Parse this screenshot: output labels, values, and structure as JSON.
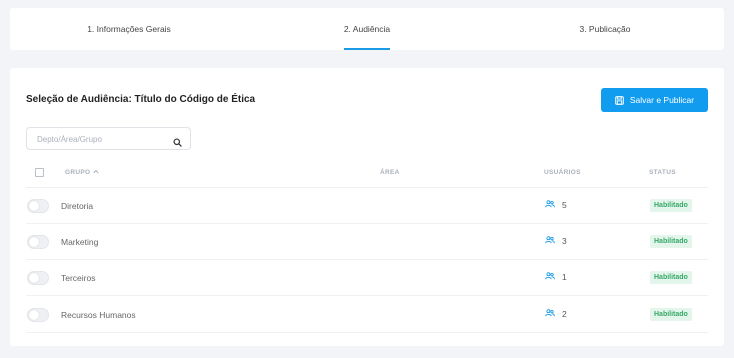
{
  "stepper": {
    "steps": [
      {
        "label": "1. Informações Gerais"
      },
      {
        "label": "2. Audiência"
      },
      {
        "label": "3. Publicação"
      }
    ],
    "active_step": 2
  },
  "main": {
    "title": "Seleção de Audiência: Título do Código de Ética",
    "publish_label": "Salvar e Publicar",
    "search_placeholder": "Depto/Área/Grupo",
    "search_value": ""
  },
  "table": {
    "headers": {
      "grupo": "GRUPO",
      "area": "ÁREA",
      "usuarios": "USUÁRIOS",
      "status": "STATUS"
    },
    "sort": {
      "column": "grupo",
      "direction": "asc"
    },
    "rows": [
      {
        "grupo": "Diretoria",
        "area": "",
        "usuarios": "5",
        "status": "Habilitado",
        "enabled": false
      },
      {
        "grupo": "Marketing",
        "area": "",
        "usuarios": "3",
        "status": "Habilitado",
        "enabled": false
      },
      {
        "grupo": "Terceiros",
        "area": "",
        "usuarios": "1",
        "status": "Habilitado",
        "enabled": false
      },
      {
        "grupo": "Recursos Humanos",
        "area": "",
        "usuarios": "2",
        "status": "Habilitado",
        "enabled": false
      }
    ]
  },
  "icons": {
    "publish": "save-icon",
    "search": "search-icon",
    "sort": "chevron-up-icon",
    "users": "users-icon"
  },
  "colors": {
    "accent": "#129cf0",
    "status_text": "#35a866",
    "status_bg": "#e4f6ec",
    "background": "#f2f4f7"
  }
}
